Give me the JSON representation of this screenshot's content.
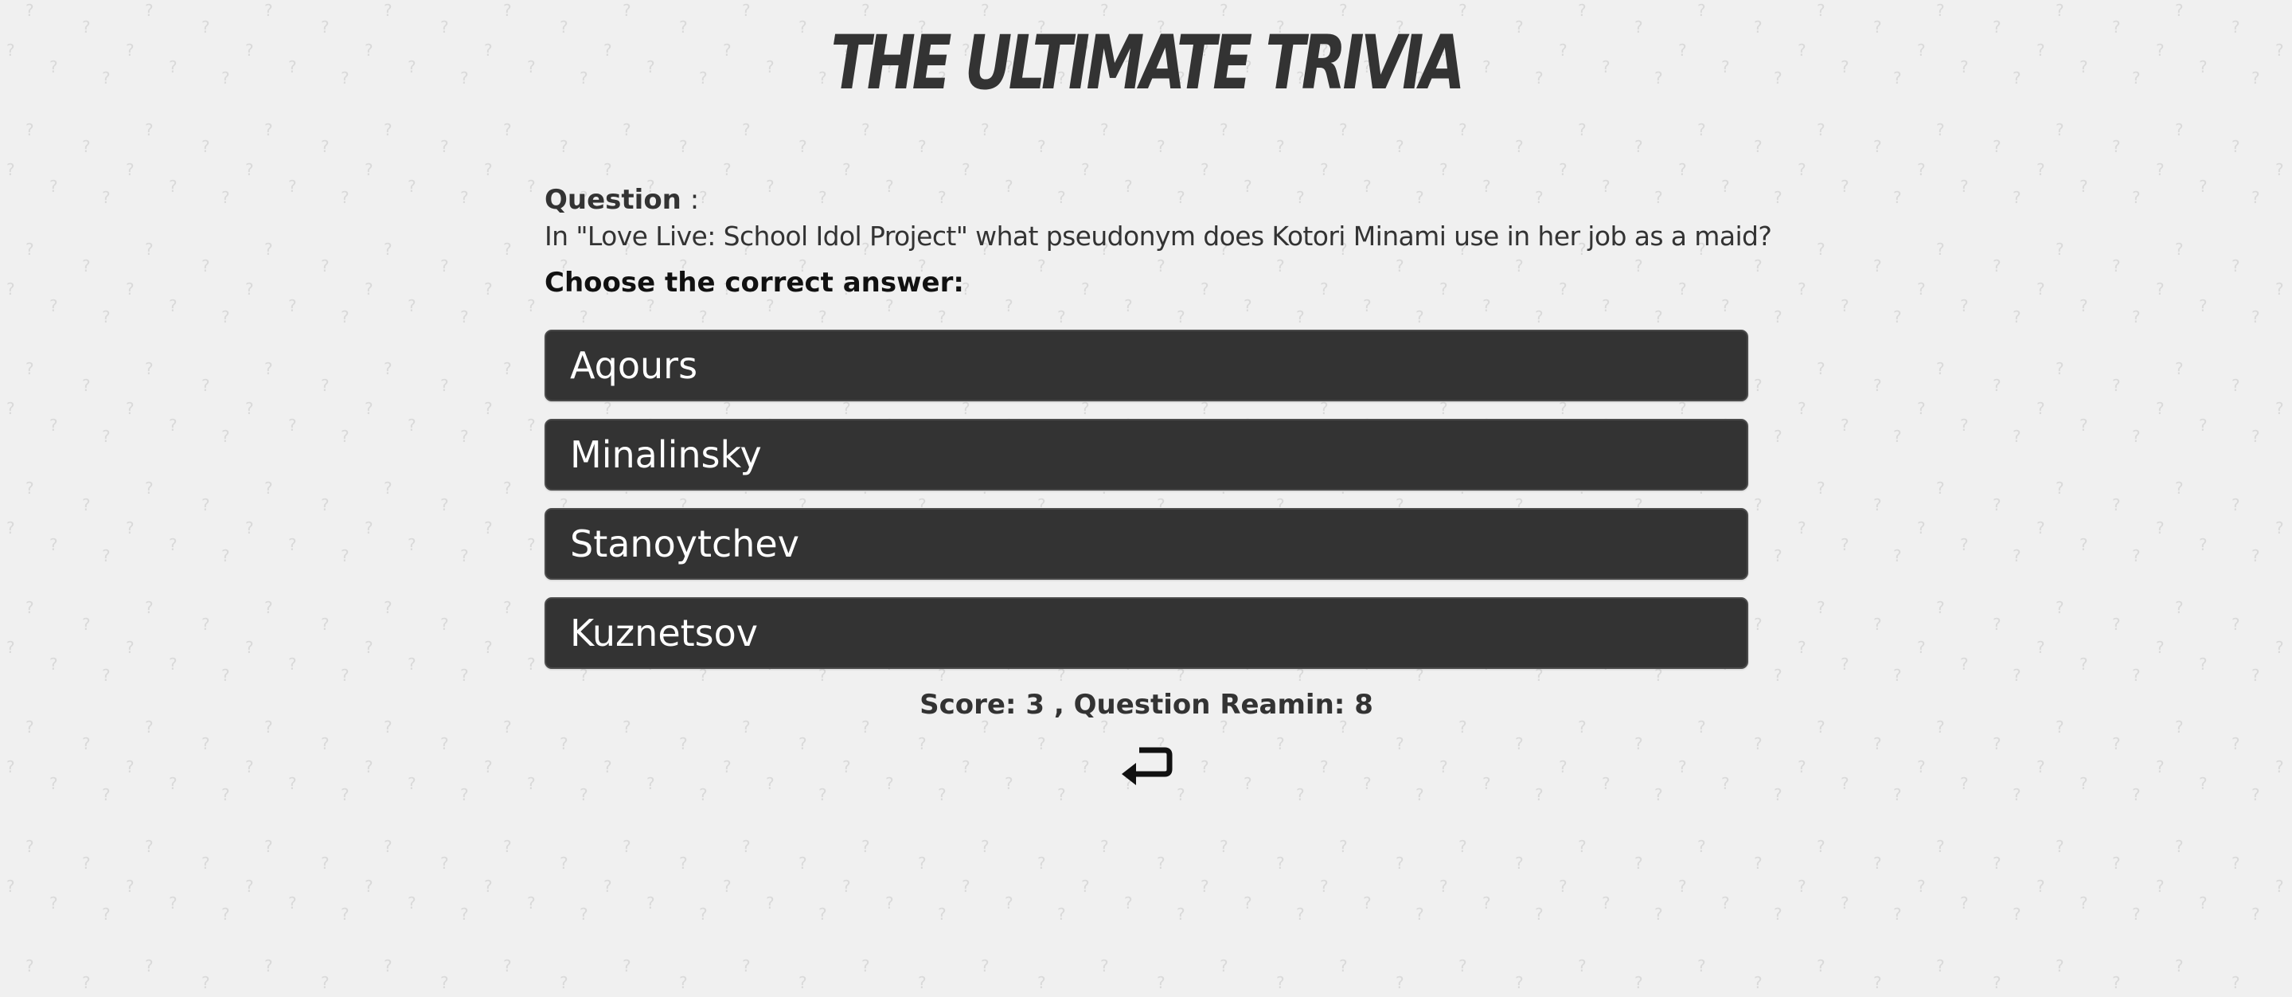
{
  "header": {
    "title": "THE ULTIMATE TRIVIA"
  },
  "question": {
    "label": "Question",
    "separator": " :",
    "text": "In \"Love Live: School Idol Project\" what pseudonym does Kotori Minami use in her job as a maid?",
    "prompt": "Choose the correct answer:"
  },
  "answers": [
    {
      "label": "Aqours"
    },
    {
      "label": "Minalinsky"
    },
    {
      "label": "Stanoytchev"
    },
    {
      "label": "Kuznetsov"
    }
  ],
  "status": {
    "text": "Score: 3 , Question Reamin: 8",
    "score": 3,
    "questions_remaining": 8
  },
  "icons": {
    "back": "return-arrow-icon",
    "background": "question-mark-icon"
  },
  "colors": {
    "background": "#f0f0f0",
    "button": "#333333",
    "button_text": "#ffffff",
    "text": "#333333"
  }
}
